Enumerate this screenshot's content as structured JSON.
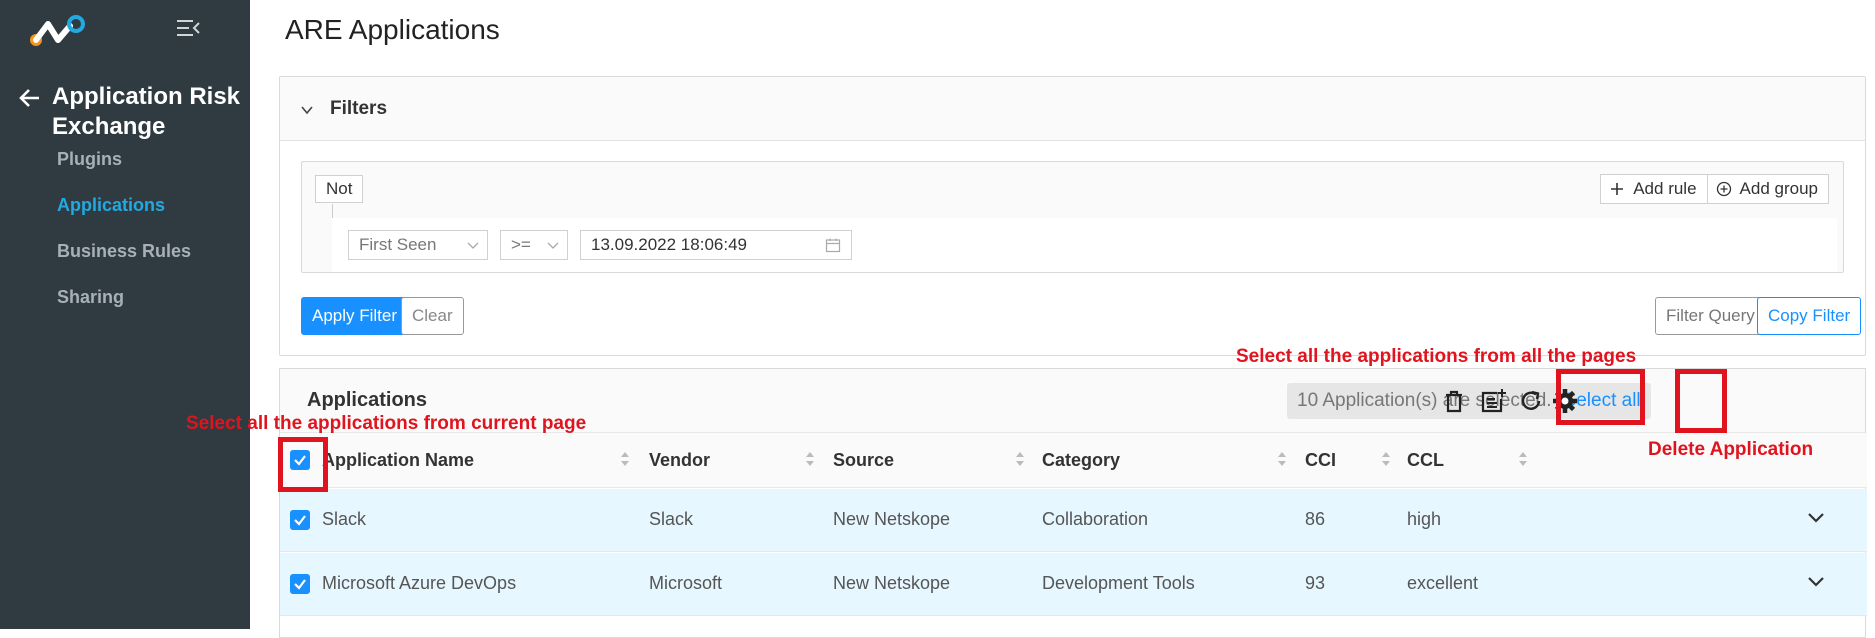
{
  "sidebar": {
    "back_label": "Application Risk Exchange",
    "items": [
      {
        "label": "Plugins",
        "active": false
      },
      {
        "label": "Applications",
        "active": true
      },
      {
        "label": "Business Rules",
        "active": false
      },
      {
        "label": "Sharing",
        "active": false
      }
    ],
    "colors": {
      "background": "#2f3a41",
      "active": "#22a9e1"
    }
  },
  "page": {
    "title": "ARE Applications"
  },
  "filters": {
    "title": "Filters",
    "not_label": "Not",
    "add_rule_label": "Add rule",
    "add_group_label": "Add group",
    "rule": {
      "field": "First Seen",
      "operator": ">=",
      "value": "13.09.2022 18:06:49"
    },
    "apply_label": "Apply Filter",
    "clear_label": "Clear",
    "filter_query_label": "Filter Query",
    "copy_filter_label": "Copy Filter"
  },
  "applications": {
    "title": "Applications",
    "selected_text": "10 Application(s) are selected.",
    "select_all_label": "Select all",
    "columns": [
      "Application Name",
      "Vendor",
      "Source",
      "Category",
      "CCI",
      "CCL"
    ],
    "rows": [
      {
        "name": "Slack",
        "vendor": "Slack",
        "source": "New Netskope",
        "category": "Collaboration",
        "cci": "86",
        "ccl": "high"
      },
      {
        "name": "Microsoft Azure DevOps",
        "vendor": "Microsoft",
        "source": "New Netskope",
        "category": "Development Tools",
        "cci": "93",
        "ccl": "excellent"
      }
    ]
  },
  "annotations": {
    "select_all_pages": "Select all the applications from all the pages",
    "select_current_page": "Select all the applications from current page",
    "delete_application": "Delete Application"
  },
  "colors": {
    "primary": "#1890ff",
    "annotation": "#e0141e",
    "row_selected": "#e6f7ff"
  }
}
